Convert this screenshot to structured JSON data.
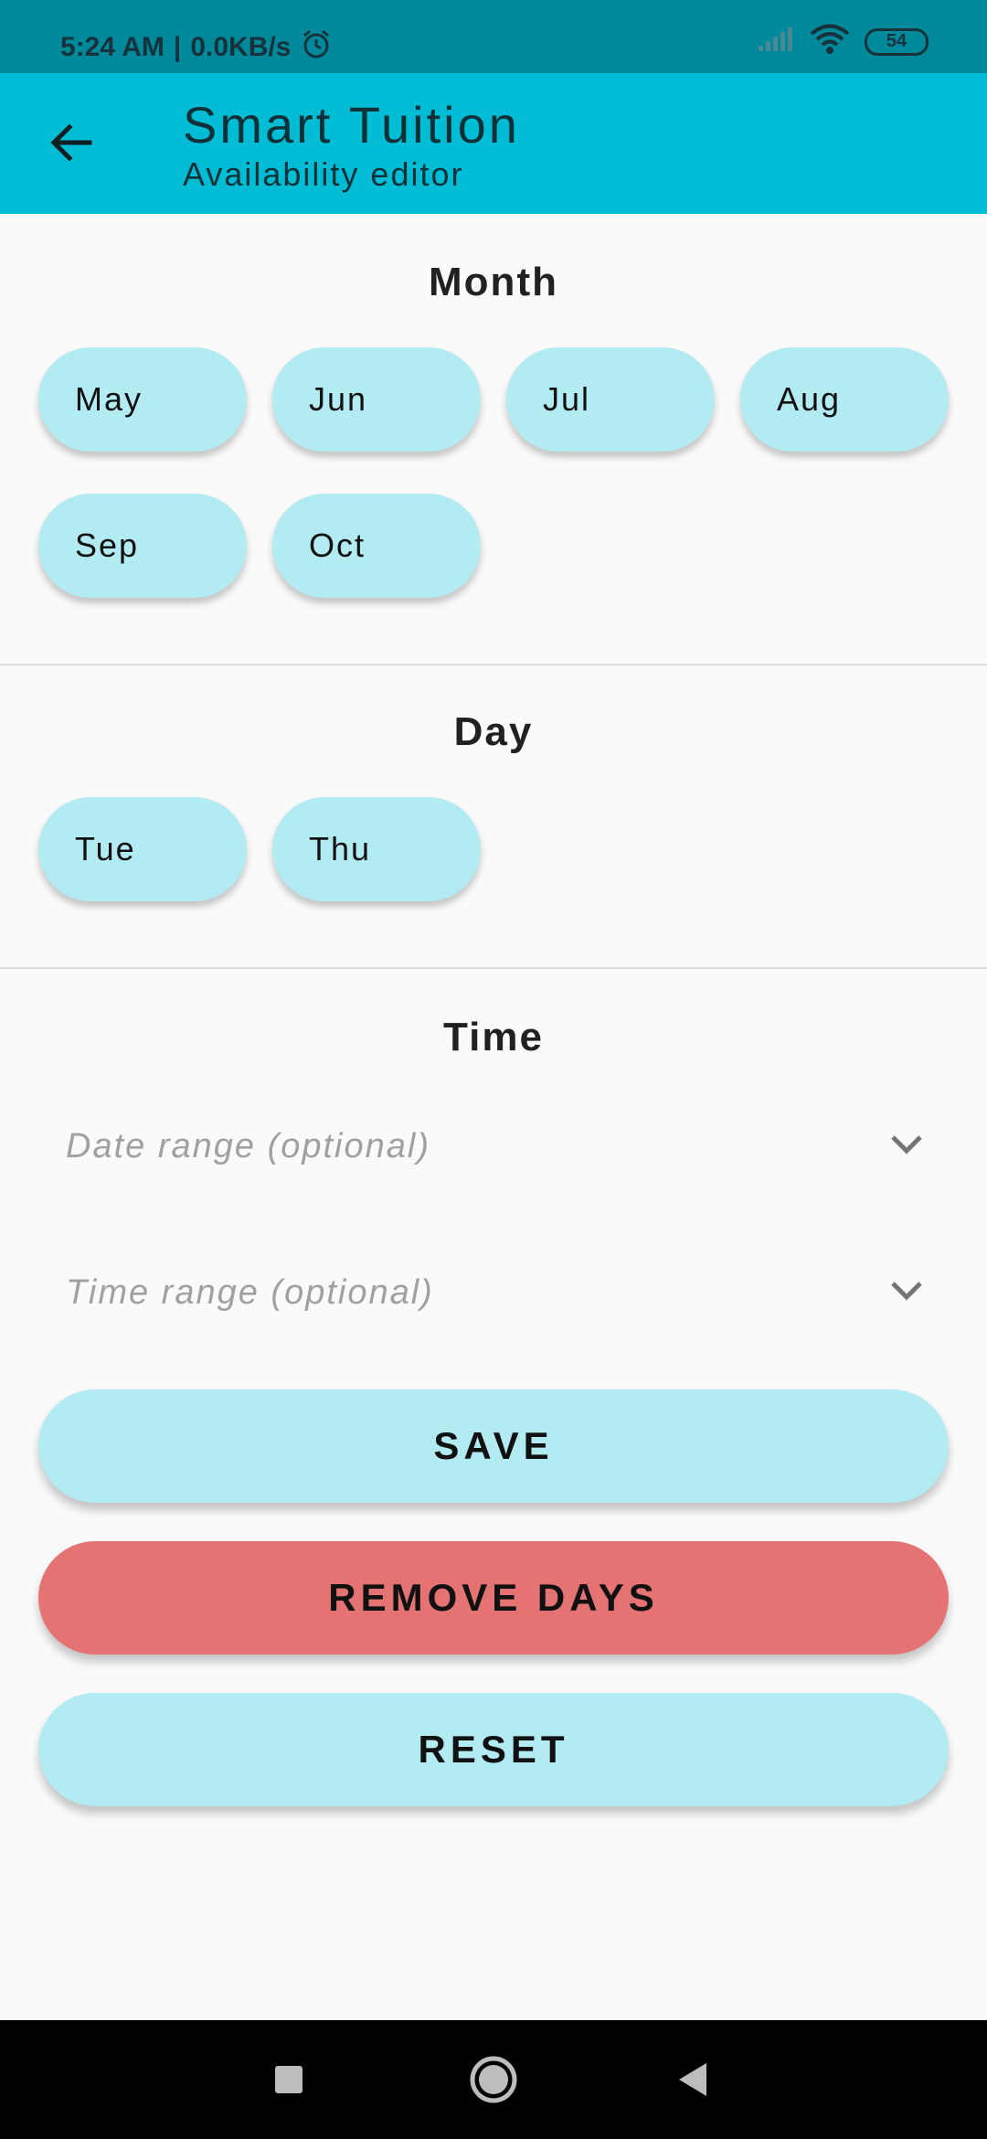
{
  "status_bar": {
    "time": "5:24 AM",
    "network_speed": "0.0KB/s",
    "separator": "|",
    "battery": "54",
    "icons": [
      "alarm-icon",
      "signal-icon",
      "wifi-icon",
      "battery-icon"
    ]
  },
  "app_bar": {
    "title": "Smart Tuition",
    "subtitle": "Availability editor",
    "back_icon": "arrow-back-icon",
    "color": "#00bcd4"
  },
  "sections": {
    "month": {
      "title": "Month",
      "chips": [
        "May",
        "Jun",
        "Jul",
        "Aug",
        "Sep",
        "Oct"
      ]
    },
    "day": {
      "title": "Day",
      "chips": [
        "Tue",
        "Thu"
      ]
    },
    "time": {
      "title": "Time",
      "date_range_placeholder": "Date range (optional)",
      "time_range_placeholder": "Time range (optional)"
    }
  },
  "buttons": {
    "save": "SAVE",
    "remove_days": "REMOVE DAYS",
    "reset": "RESET"
  },
  "colors": {
    "chip": "#b2ebf2",
    "danger": "#e57373",
    "status_bar": "#00889b"
  },
  "nav_bar": {
    "icons": [
      "recents-square-icon",
      "home-circle-icon",
      "back-triangle-icon"
    ]
  }
}
